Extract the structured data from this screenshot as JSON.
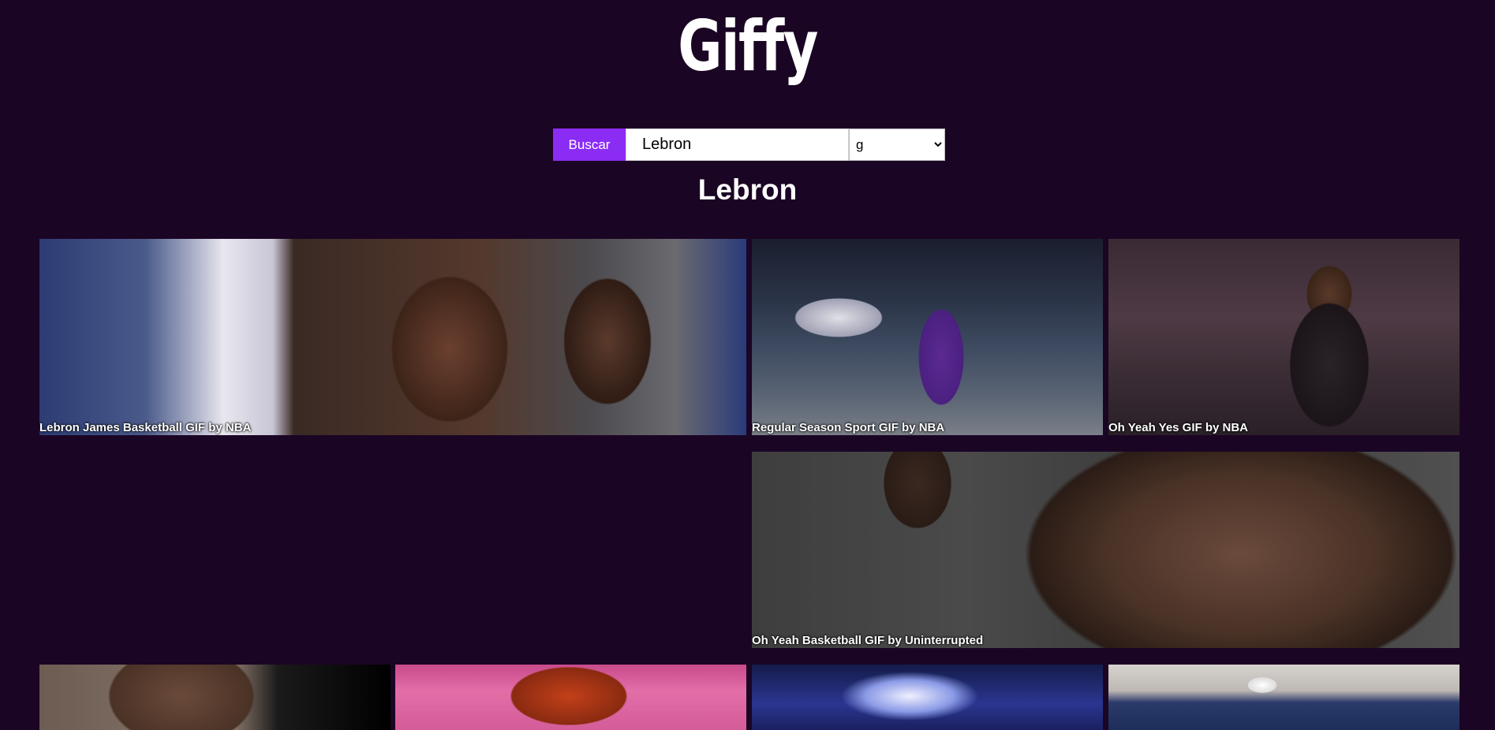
{
  "app": {
    "logo": "Giffy"
  },
  "search": {
    "button_label": "Buscar",
    "value": "Lebron",
    "rating_options": [
      "g"
    ],
    "rating_selected": "g"
  },
  "results": {
    "heading": "Lebron",
    "gifs": [
      {
        "title": "Lebron James Basketball GIF by NBA"
      },
      {
        "title": "Regular Season Sport GIF by NBA"
      },
      {
        "title": "Oh Yeah Yes GIF by NBA"
      },
      {
        "title": "Oh Yeah Basketball GIF by Uninterrupted"
      },
      {
        "title": ""
      },
      {
        "title": ""
      },
      {
        "title": ""
      },
      {
        "title": ""
      }
    ]
  },
  "colors": {
    "background": "#1b0524",
    "accent": "#8b2cf5"
  }
}
